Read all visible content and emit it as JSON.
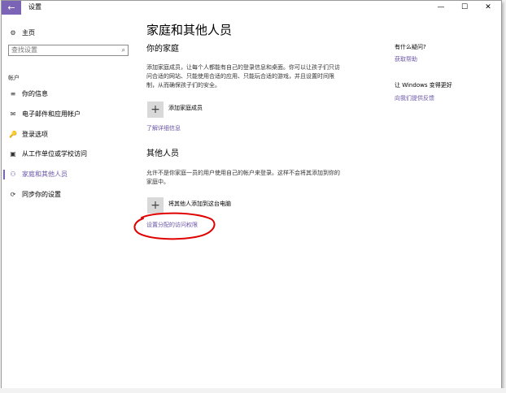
{
  "window": {
    "title": "设置",
    "back_icon": "←",
    "minimize": "—",
    "maximize": "☐",
    "close": "✕"
  },
  "sidebar": {
    "home": {
      "icon": "⚙",
      "label": "主页"
    },
    "search": {
      "placeholder": "查找设置",
      "icon": "⌕"
    },
    "section_label": "帐户",
    "items": [
      {
        "icon": "≡",
        "label": "你的信息"
      },
      {
        "icon": "✉",
        "label": "电子邮件和应用帐户"
      },
      {
        "icon": "🔑",
        "label": "登录选项"
      },
      {
        "icon": "▣",
        "label": "从工作单位或学校访问"
      },
      {
        "icon": "⚇",
        "label": "家庭和其他人员",
        "active": true
      },
      {
        "icon": "⟳",
        "label": "同步你的设置"
      }
    ]
  },
  "main": {
    "title": "家庭和其他人员",
    "family": {
      "heading": "你的家庭",
      "description": "添加家庭成员，让每个人都能有自己的登录信息和桌面。你可以让孩子们只访问合适的网站、只能使用合适的应用、只能玩合适的游戏，并且设置时间限制，从而确保孩子们的安全。",
      "add_label": "添加家庭成员",
      "learn_more": "了解详细信息"
    },
    "others": {
      "heading": "其他人员",
      "description": "允许不是你家庭一员的用户使用自己的帐户来登录。这样不会将其添加到你的家庭中。",
      "add_label": "将其他人添加到这台电脑",
      "assigned_access": "设置分配的访问权限"
    }
  },
  "help": {
    "question": "有什么疑问?",
    "get_help": "获取帮助",
    "improve": "让 Windows 变得更好",
    "feedback": "向我们提供反馈"
  },
  "annotation_color": "#e00000",
  "accent_color": "#7b63b6"
}
